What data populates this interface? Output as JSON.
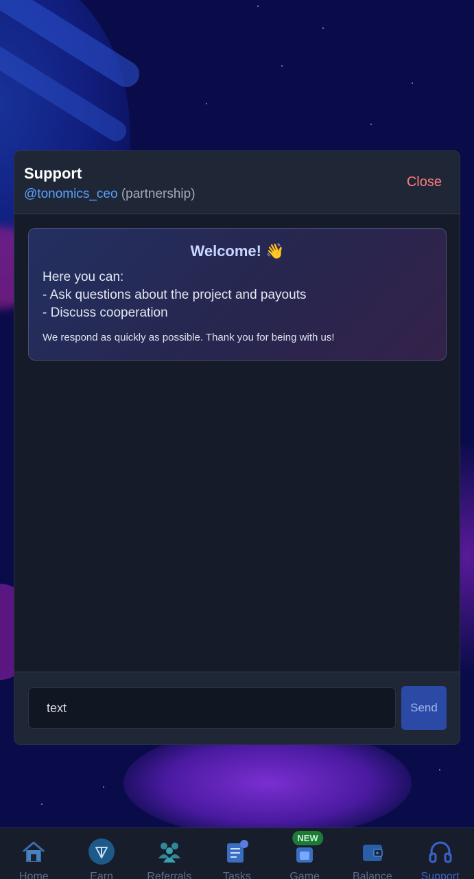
{
  "modal": {
    "title": "Support",
    "handle": "@tonomics_ceo",
    "role": "(partnership)",
    "close_label": "Close"
  },
  "welcome": {
    "title": "Welcome! 👋",
    "lines": [
      "Here you can:",
      "- Ask questions about the project and payouts",
      "- Discuss cooperation"
    ],
    "note": "We respond as quickly as possible. Thank you for being with us!"
  },
  "composer": {
    "input_value": "text",
    "send_label": "Send"
  },
  "tabs": [
    {
      "label": "Home",
      "icon": "home-icon"
    },
    {
      "label": "Earn",
      "icon": "ton-icon"
    },
    {
      "label": "Referrals",
      "icon": "users-icon"
    },
    {
      "label": "Tasks",
      "icon": "tasks-icon"
    },
    {
      "label": "Game",
      "icon": "game-icon",
      "badge": "NEW"
    },
    {
      "label": "Balance",
      "icon": "wallet-icon"
    },
    {
      "label": "Support",
      "icon": "headphones-icon",
      "active": true
    }
  ],
  "colors": {
    "accent": "#3a63c8",
    "close": "#ff7b7b",
    "handle": "#5aa0ff",
    "badge": "#1f7a3a"
  }
}
